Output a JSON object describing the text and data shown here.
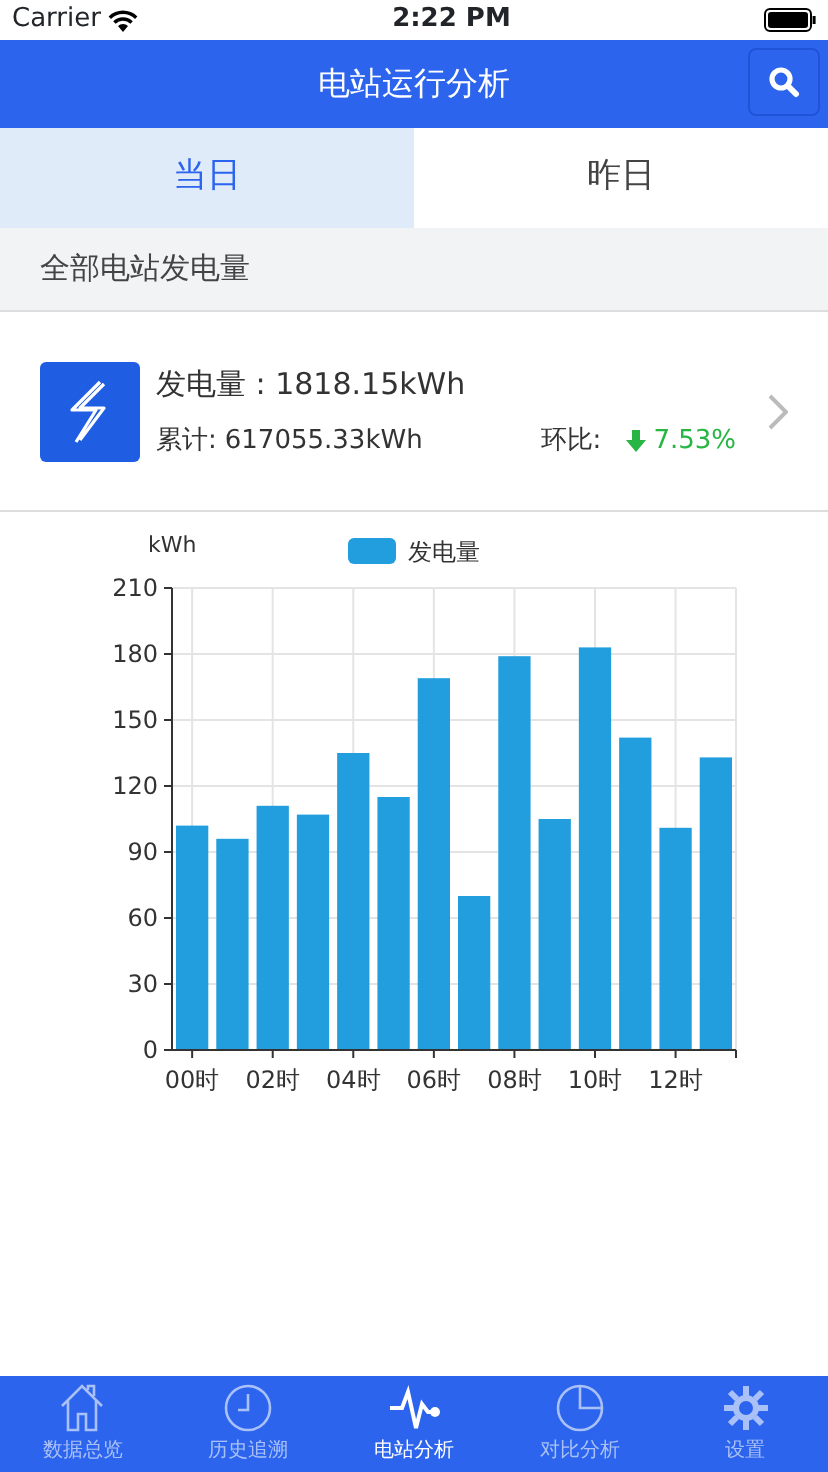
{
  "status_bar": {
    "carrier": "Carrier",
    "time": "2:22 PM"
  },
  "nav_bar": {
    "title": "电站运行分析"
  },
  "tabs": [
    {
      "label": "当日",
      "selected": true
    },
    {
      "label": "昨日",
      "selected": false
    }
  ],
  "section_title": "全部电站发电量",
  "summary": {
    "generation": "发电量 : 1818.15kWh",
    "total_label": "累计:",
    "total": "617055.33kWh",
    "ratio_label": "环比:",
    "ratio": "7.53%",
    "down": true
  },
  "chart": {
    "chart_data": {
      "type": "bar",
      "ylabel": "kWh",
      "grid": true,
      "xlim": [
        -0.5,
        13.5
      ],
      "x": [
        0,
        1,
        2,
        3,
        4,
        5,
        6,
        7,
        8,
        9,
        10,
        11,
        12,
        13
      ],
      "series": [
        {
          "name": "发电量",
          "color": "#229ddd",
          "values": [
            102,
            96,
            111,
            107,
            135,
            115,
            169,
            70,
            179,
            105,
            183,
            142,
            101,
            133
          ]
        }
      ],
      "ylim": [
        0,
        210
      ],
      "yticks": [
        0,
        30,
        60,
        90,
        120,
        150,
        180,
        210
      ],
      "xticks": [
        {
          "value": 0,
          "label": "00时"
        },
        {
          "value": 2,
          "label": "02时"
        },
        {
          "value": 4,
          "label": "04时"
        },
        {
          "value": 6,
          "label": "06时"
        },
        {
          "value": 8,
          "label": "08时"
        },
        {
          "value": 10,
          "label": "10时"
        },
        {
          "value": 12,
          "label": "12时"
        }
      ]
    }
  },
  "tab_bar": [
    {
      "label": "数据总览",
      "selected": false
    },
    {
      "label": "历史追溯",
      "selected": false
    },
    {
      "label": "电站分析",
      "selected": true
    },
    {
      "label": "对比分析",
      "selected": false
    },
    {
      "label": "设置",
      "selected": false
    }
  ]
}
